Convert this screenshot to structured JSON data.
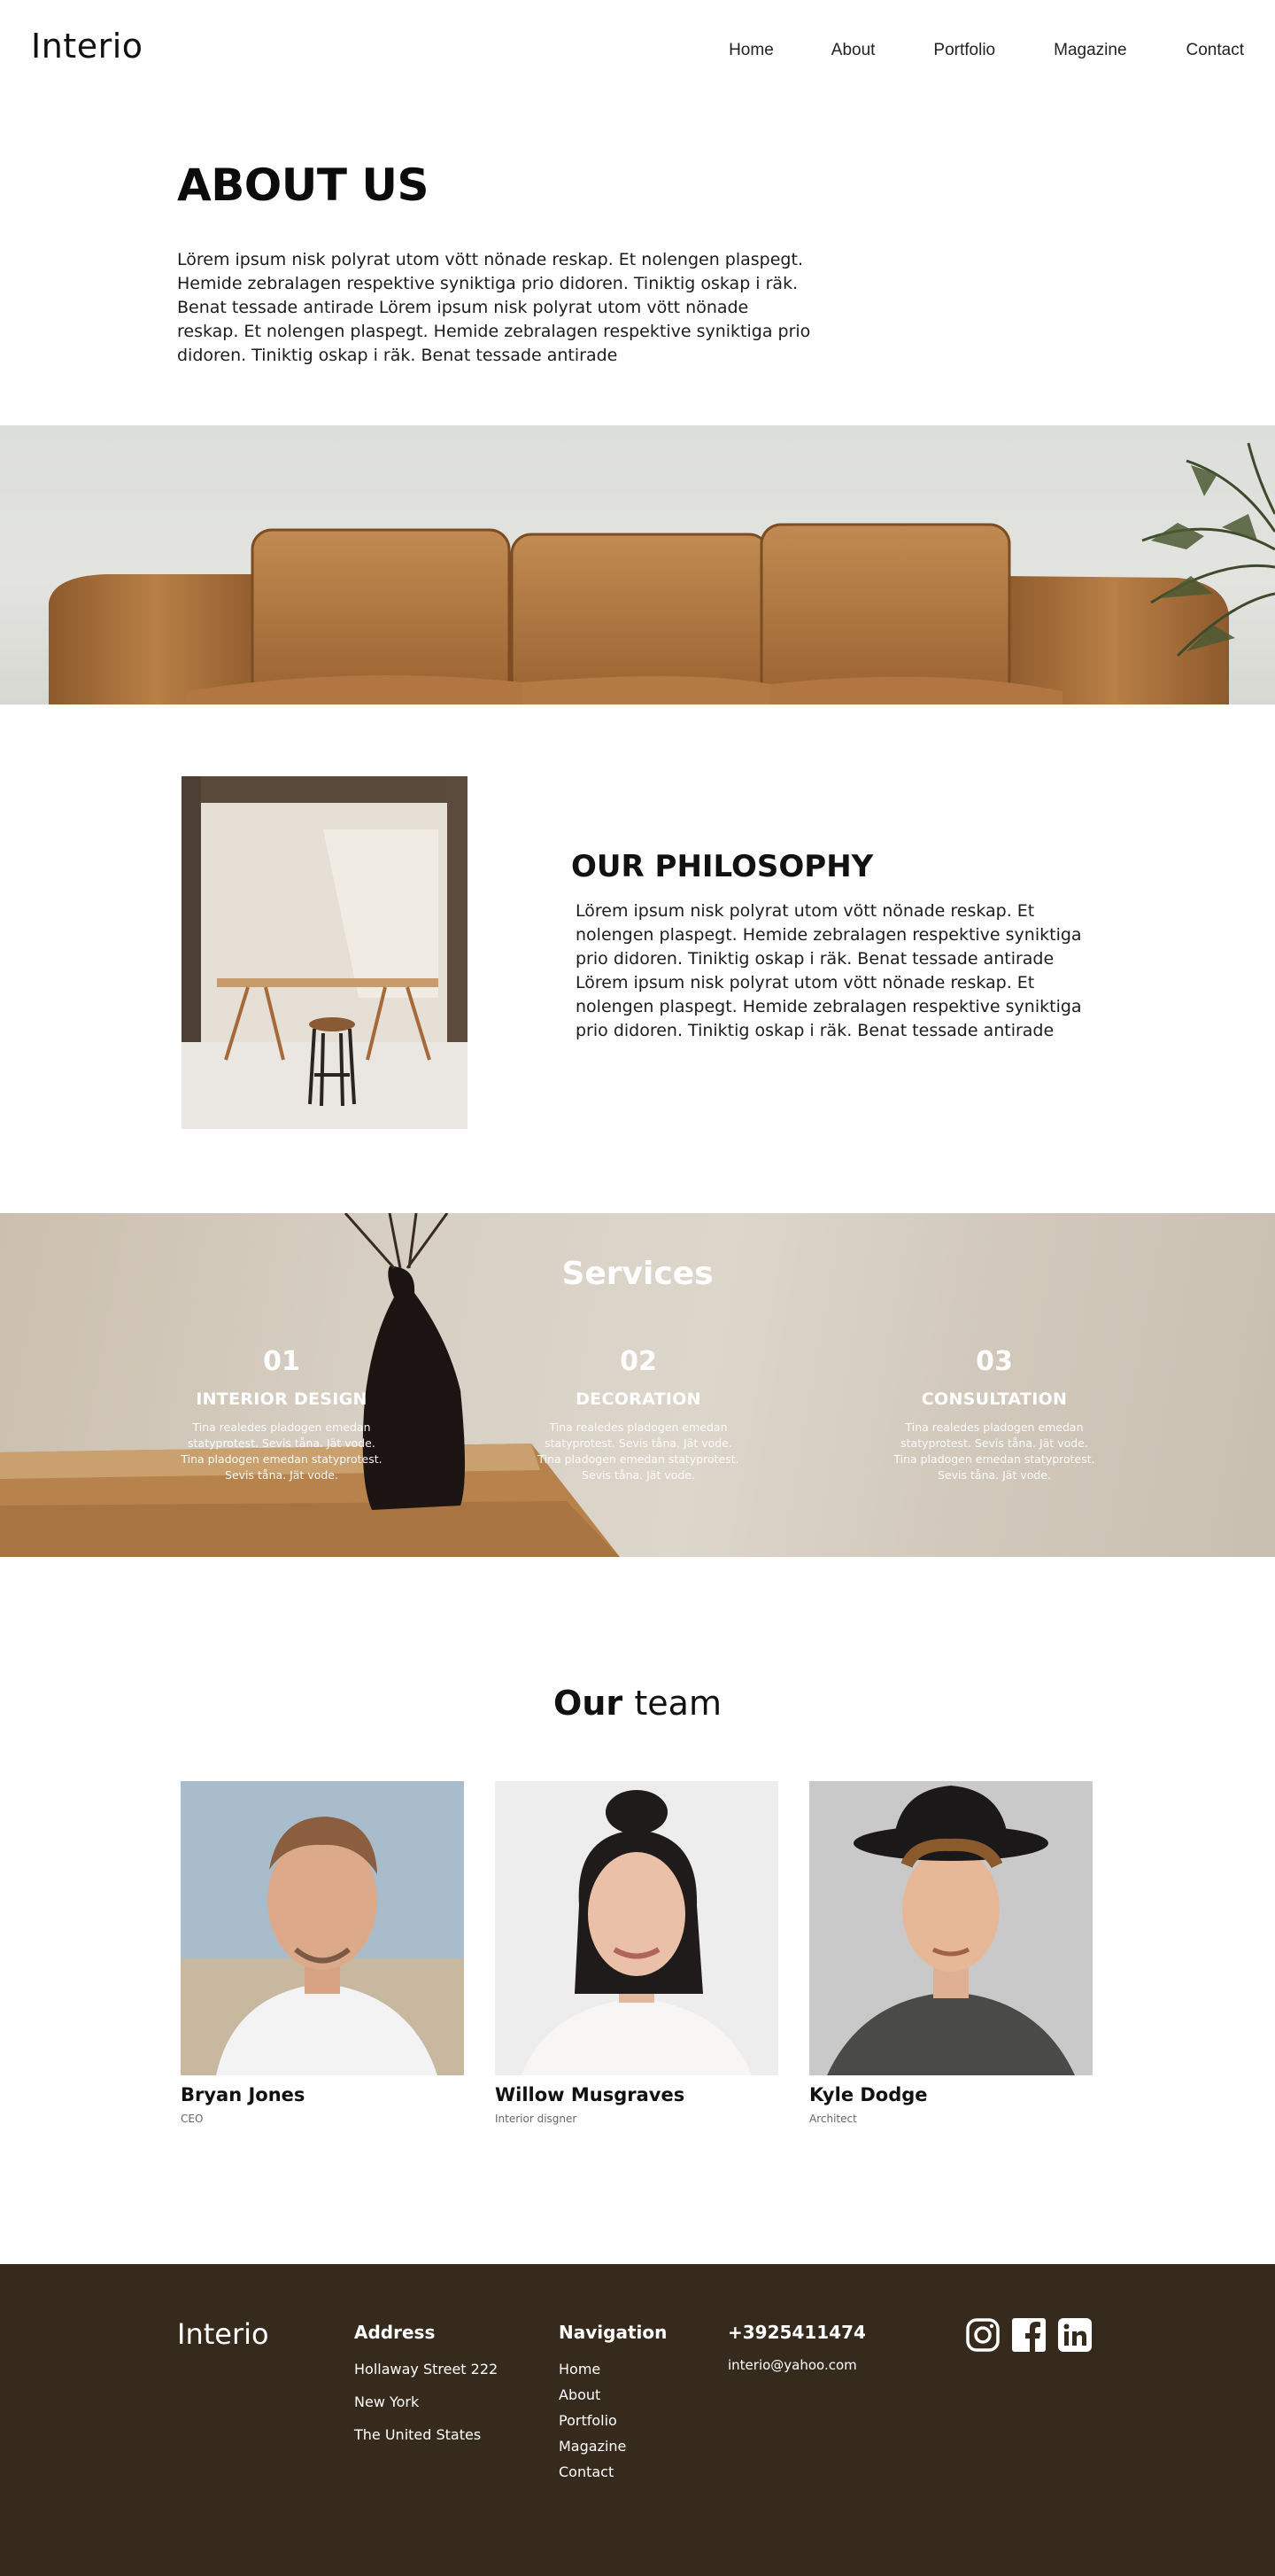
{
  "header": {
    "logo": "Interio",
    "nav": [
      "Home",
      "About",
      "Portfolio",
      "Magazine",
      "Contact"
    ]
  },
  "about": {
    "title": "ABOUT US",
    "text": "Lörem ipsum nisk polyrat utom vött nönade reskap. Et nolengen plaspegt. Hemide zebralagen respektive syniktiga prio didoren. Tiniktig oskap i räk. Benat tessade antirade Lörem ipsum nisk polyrat utom vött nönade reskap. Et nolengen plaspegt. Hemide zebralagen respektive syniktiga prio didoren. Tiniktig oskap i räk. Benat tessade antirade"
  },
  "philosophy": {
    "title": "OUR PHILOSOPHY",
    "text": "Lörem ipsum nisk polyrat utom vött nönade reskap. Et nolengen plaspegt. Hemide zebralagen respektive syniktiga prio didoren. Tiniktig oskap i räk. Benat tessade antirade Lörem ipsum nisk polyrat utom vött nönade reskap. Et nolengen plaspegt. Hemide zebralagen respektive syniktiga prio didoren. Tiniktig oskap i räk. Benat tessade antirade"
  },
  "services": {
    "title": "Services",
    "items": [
      {
        "num": "01",
        "name": "INTERIOR DESIGN",
        "text": "Tina realedes pladogen emedan statyprotest. Sevis tåna. Jät vode. Tina pladogen emedan statyprotest. Sevis tåna. Jät vode."
      },
      {
        "num": "02",
        "name": "DECORATION",
        "text": "Tina realedes pladogen emedan statyprotest. Sevis tåna. Jät vode. Tina pladogen emedan statyprotest. Sevis tåna. Jät vode."
      },
      {
        "num": "03",
        "name": "CONSULTATION",
        "text": "Tina realedes pladogen emedan statyprotest. Sevis tåna. Jät vode. Tina pladogen emedan statyprotest. Sevis tåna. Jät vode."
      }
    ]
  },
  "team": {
    "title_bold": "Our",
    "title_light": "team",
    "members": [
      {
        "name": "Bryan Jones",
        "role": "CEO"
      },
      {
        "name": "Willow Musgraves",
        "role": "Interior disgner"
      },
      {
        "name": "Kyle Dodge",
        "role": "Architect"
      }
    ]
  },
  "footer": {
    "logo": "Interio",
    "address_title": "Address",
    "address_lines": [
      "Hollaway Street 222",
      "New York",
      "The United States"
    ],
    "nav_title": "Navigation",
    "nav_items": [
      "Home",
      "About",
      "Portfolio",
      "Magazine",
      "Contact"
    ],
    "phone": "+3925411474",
    "email": "interio@yahoo.com",
    "socials": [
      "instagram-icon",
      "facebook-icon",
      "linkedin-icon"
    ]
  },
  "colors": {
    "footer_bg": "#362a1d",
    "sofa_leather": "#b0773f",
    "accent_text": "#111111"
  }
}
